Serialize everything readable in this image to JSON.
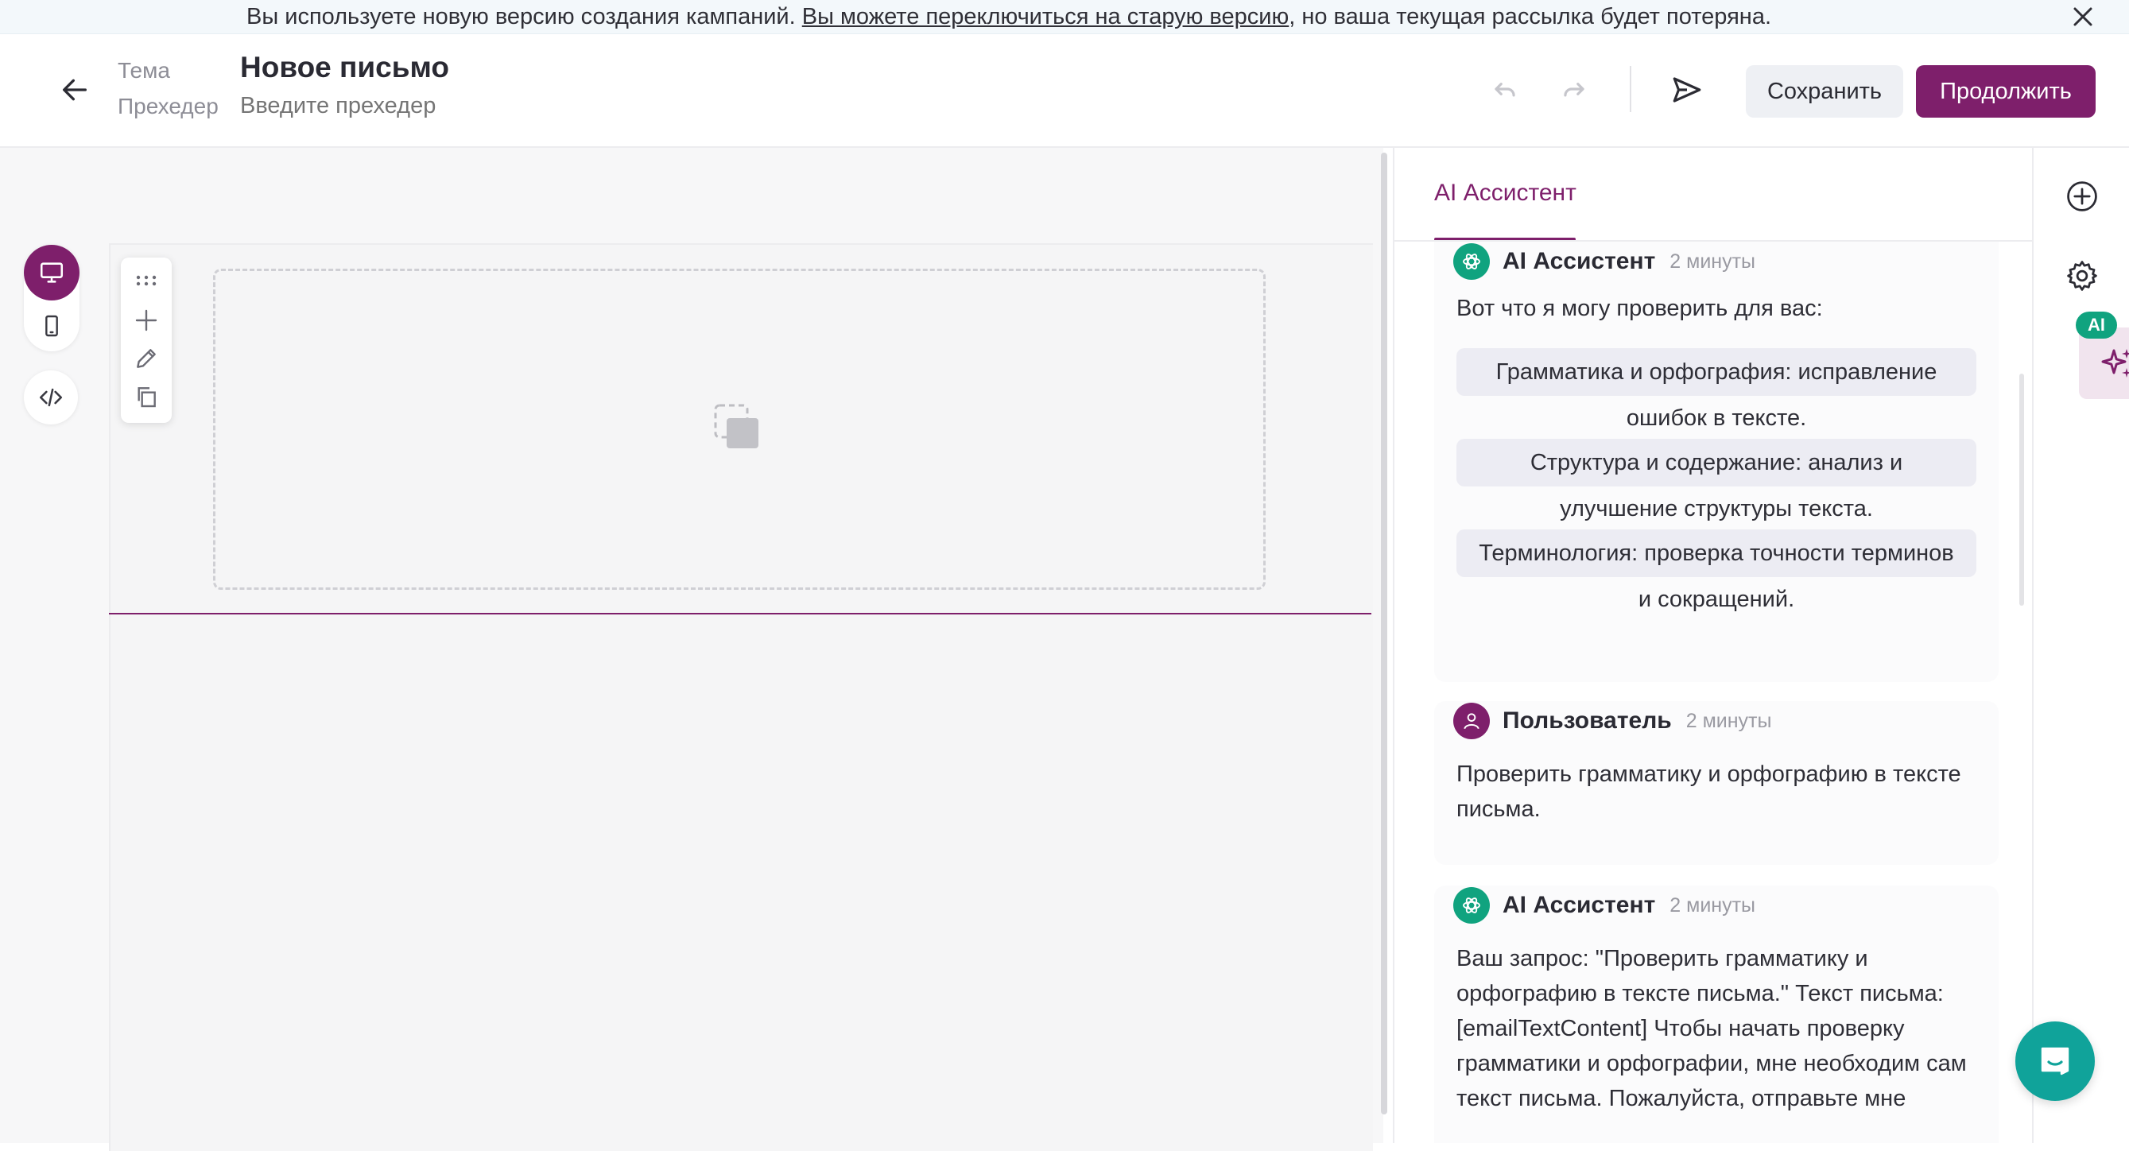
{
  "banner": {
    "text_before": "Вы используете новую версию создания кампаний. ",
    "link_text": "Вы можете переключиться на старую версию",
    "text_after": ", но ваша текущая рассылка будет потеряна."
  },
  "header": {
    "subject_label": "Тема",
    "subject_value": "Новое письмо",
    "preheader_label": "Прехедер",
    "preheader_placeholder": "Введите прехедер",
    "save_label": "Сохранить",
    "continue_label": "Продолжить"
  },
  "panel": {
    "tab_label": "AI Ассистент",
    "messages": [
      {
        "author": "AI Ассистент",
        "time": "2 минуты",
        "intro": "Вот что я могу проверить для вас:",
        "items": [
          {
            "line1": "Грамматика и орфография: исправление",
            "line2": "ошибок в тексте."
          },
          {
            "line1": "Структура и содержание: анализ и",
            "line2": "улучшение структуры текста."
          },
          {
            "line1": "Терминология: проверка точности терминов",
            "line2": "и сокращений."
          }
        ]
      },
      {
        "author": "Пользователь",
        "time": "2 минуты",
        "text": "Проверить грамматику и орфографию в тексте письма."
      },
      {
        "author": "AI Ассистент",
        "time": "2 минуты",
        "text": "Ваш запрос: \"Проверить грамматику и орфографию в тексте письма.\" Текст письма: [emailTextContent] Чтобы начать проверку грамматики и орфографии, мне необходим сам текст письма. Пожалуйста, отправьте мне"
      }
    ]
  },
  "rail": {
    "ai_badge": "AI"
  },
  "colors": {
    "brand": "#7e1f6b",
    "ai_green": "#10a37f",
    "chat_launcher": "#10a39a"
  },
  "icons": [
    "close-icon",
    "back-arrow-icon",
    "undo-icon",
    "redo-icon",
    "send-icon",
    "desktop-icon",
    "mobile-icon",
    "code-icon",
    "drag-handle-icon",
    "plus-icon",
    "pencil-icon",
    "copy-icon",
    "image-placeholder-icon",
    "openai-icon",
    "user-icon",
    "add-circle-icon",
    "gear-icon",
    "sparkles-icon",
    "chat-icon"
  ]
}
